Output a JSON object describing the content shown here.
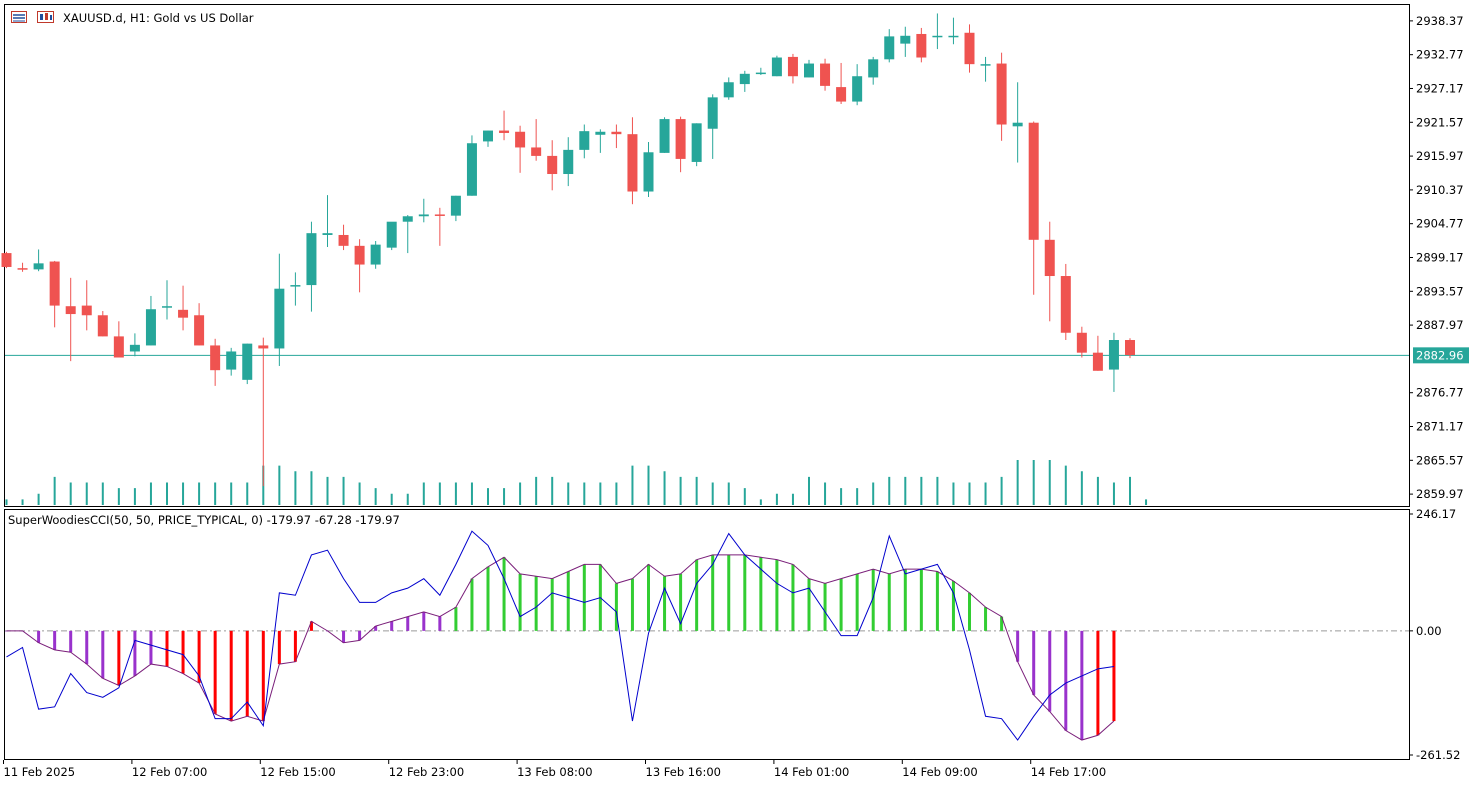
{
  "header": {
    "symbol_title": "XAUUSD.d, H1:  Gold vs US Dollar",
    "indicator_title": "SuperWoodiesCCI(50, 50, PRICE_TYPICAL, 0) -179.97 -67.28 -179.97"
  },
  "icons": {
    "symbol_icon": "chart-window-icon",
    "indicator_icon": "indicator-icon"
  },
  "colors": {
    "bull": "#26a69a",
    "bear": "#ef5350",
    "volume": "#26a69a",
    "price_line": "#26a69a",
    "cci_green": "#32cd32",
    "cci_red": "#ff0000",
    "cci_purple": "#9932cc",
    "cci_line_main": "#0000cd",
    "cci_line_turbo": "#7a1f7a"
  },
  "current_price_label": "2882.96",
  "chart_data": [
    {
      "type": "candlestick",
      "title": "XAUUSD.d, H1:  Gold vs US Dollar",
      "ylim": [
        2858.0,
        2941.0
      ],
      "y_ticks": [
        "2938.37",
        "2932.77",
        "2927.17",
        "2921.57",
        "2915.97",
        "2910.37",
        "2904.77",
        "2899.17",
        "2893.57",
        "2887.97",
        "2876.77",
        "2871.17",
        "2865.57",
        "2859.97"
      ],
      "x_ticks": [
        "11 Feb 2025",
        "12 Feb 07:00",
        "12 Feb 15:00",
        "12 Feb 23:00",
        "13 Feb 08:00",
        "13 Feb 16:00",
        "14 Feb 01:00",
        "14 Feb 09:00",
        "14 Feb 17:00"
      ],
      "x_tick_bars": [
        0,
        8,
        16,
        24,
        32,
        40,
        48,
        56,
        64
      ],
      "current_price": 2882.96,
      "ohlc": [
        [
          2899.9,
          2900.1,
          2897.4,
          2897.6
        ],
        [
          2897.4,
          2898.3,
          2896.8,
          2897.2
        ],
        [
          2897.2,
          2900.5,
          2896.9,
          2898.2
        ],
        [
          2898.5,
          2898.6,
          2887.6,
          2891.2
        ],
        [
          2891.1,
          2895.8,
          2882.0,
          2889.8
        ],
        [
          2891.2,
          2895.4,
          2887.1,
          2889.6
        ],
        [
          2889.6,
          2890.3,
          2886.1,
          2886.1
        ],
        [
          2886.1,
          2888.6,
          2883.1,
          2882.6
        ],
        [
          2883.6,
          2886.6,
          2882.8,
          2884.7
        ],
        [
          2884.6,
          2892.8,
          2884.6,
          2890.6
        ],
        [
          2891.1,
          2895.4,
          2888.9,
          2891.1
        ],
        [
          2890.5,
          2894.5,
          2887.1,
          2889.2
        ],
        [
          2889.6,
          2891.6,
          2884.6,
          2884.6
        ],
        [
          2884.6,
          2885.7,
          2877.9,
          2880.5
        ],
        [
          2880.6,
          2884.2,
          2879.6,
          2883.6
        ],
        [
          2878.9,
          2884.9,
          2878.2,
          2884.9
        ],
        [
          2884.6,
          2885.9,
          2861.3,
          2884.1
        ],
        [
          2884.1,
          2899.8,
          2881.2,
          2894.0
        ],
        [
          2894.5,
          2896.7,
          2891.2,
          2894.6
        ],
        [
          2894.6,
          2905.1,
          2890.2,
          2903.2
        ],
        [
          2902.9,
          2909.5,
          2900.9,
          2903.2
        ],
        [
          2902.9,
          2904.6,
          2900.4,
          2901.1
        ],
        [
          2901.1,
          2902.2,
          2893.4,
          2898.0
        ],
        [
          2898.0,
          2901.9,
          2897.3,
          2901.3
        ],
        [
          2900.8,
          2904.6,
          2900.4,
          2905.1
        ],
        [
          2905.1,
          2906.2,
          2899.9,
          2906.0
        ],
        [
          2906.0,
          2908.9,
          2905.0,
          2906.3
        ],
        [
          2906.3,
          2907.4,
          2901.1,
          2906.1
        ],
        [
          2906.1,
          2909.4,
          2905.2,
          2909.4
        ],
        [
          2909.4,
          2919.4,
          2909.4,
          2918.1
        ],
        [
          2918.4,
          2920.2,
          2917.5,
          2920.2
        ],
        [
          2920.2,
          2923.5,
          2918.6,
          2919.8
        ],
        [
          2920.0,
          2921.0,
          2913.2,
          2917.4
        ],
        [
          2917.4,
          2922.1,
          2915.2,
          2916.0
        ],
        [
          2916.0,
          2918.6,
          2910.3,
          2913.0
        ],
        [
          2913.0,
          2919.1,
          2911.0,
          2917.0
        ],
        [
          2917.0,
          2921.2,
          2915.6,
          2920.1
        ],
        [
          2919.5,
          2920.4,
          2916.5,
          2920.0
        ],
        [
          2920.0,
          2921.2,
          2917.3,
          2919.6
        ],
        [
          2919.6,
          2922.4,
          2908.0,
          2910.1
        ],
        [
          2910.1,
          2918.3,
          2909.2,
          2916.6
        ],
        [
          2916.5,
          2922.4,
          2916.5,
          2922.1
        ],
        [
          2922.1,
          2922.5,
          2913.3,
          2915.5
        ],
        [
          2915.0,
          2921.4,
          2914.3,
          2921.4
        ],
        [
          2920.5,
          2926.2,
          2915.5,
          2925.7
        ],
        [
          2925.7,
          2929.0,
          2925.3,
          2928.2
        ],
        [
          2927.9,
          2930.1,
          2926.6,
          2929.6
        ],
        [
          2929.6,
          2930.6,
          2929.4,
          2929.8
        ],
        [
          2929.2,
          2932.6,
          2929.2,
          2932.3
        ],
        [
          2932.4,
          2932.9,
          2928.0,
          2929.2
        ],
        [
          2929.0,
          2931.9,
          2929.0,
          2931.3
        ],
        [
          2931.3,
          2932.1,
          2926.8,
          2927.6
        ],
        [
          2927.4,
          2931.4,
          2924.6,
          2925.0
        ],
        [
          2925.0,
          2931.2,
          2924.4,
          2929.2
        ],
        [
          2929.0,
          2932.4,
          2927.8,
          2932.0
        ],
        [
          2932.0,
          2937.0,
          2931.5,
          2935.8
        ],
        [
          2934.6,
          2937.4,
          2932.4,
          2935.9
        ],
        [
          2936.2,
          2937.2,
          2931.5,
          2932.3
        ],
        [
          2935.9,
          2939.6,
          2933.7,
          2935.9
        ],
        [
          2935.7,
          2938.9,
          2934.5,
          2935.9
        ],
        [
          2936.4,
          2937.8,
          2929.8,
          2931.2
        ],
        [
          2931.2,
          2932.4,
          2928.3,
          2931.2
        ],
        [
          2931.3,
          2933.1,
          2918.5,
          2921.2
        ],
        [
          2920.9,
          2928.2,
          2914.9,
          2921.5
        ],
        [
          2921.5,
          2921.7,
          2893.0,
          2902.1
        ],
        [
          2902.1,
          2905.1,
          2888.6,
          2896.1
        ],
        [
          2896.1,
          2898.1,
          2885.5,
          2886.7
        ],
        [
          2886.7,
          2887.7,
          2882.6,
          2883.4
        ],
        [
          2883.4,
          2886.2,
          2880.4,
          2880.4
        ],
        [
          2880.6,
          2886.7,
          2876.9,
          2885.5
        ],
        [
          2885.5,
          2885.8,
          2882.5,
          2883.0
        ]
      ],
      "volume": [
        1,
        1,
        2,
        5,
        4,
        4,
        4,
        3,
        3,
        4,
        4,
        4,
        4,
        4,
        4,
        4,
        7,
        7,
        6,
        6,
        5,
        5,
        4,
        3,
        2,
        2,
        4,
        4,
        4,
        4,
        3,
        3,
        4,
        5,
        5,
        4,
        4,
        4,
        4,
        7,
        7,
        6,
        5,
        5,
        4,
        4,
        3,
        1,
        2,
        2,
        5,
        4,
        3,
        3,
        4,
        5,
        5,
        5,
        5,
        4,
        4,
        4,
        5,
        8,
        8,
        8,
        7,
        6,
        5,
        4,
        5,
        1
      ],
      "volume_max": 8
    },
    {
      "type": "line-histogram",
      "title": "SuperWoodiesCCI(50, 50, PRICE_TYPICAL, 0)",
      "ylim": [
        -261.52,
        246.17
      ],
      "y_ticks": [
        "246.17",
        "0.00",
        "-261.52"
      ],
      "zero_line": 0.0,
      "hist": [
        0,
        0,
        -25,
        -40,
        -45,
        -70,
        -100,
        -115,
        -95,
        -70,
        -75,
        -90,
        -110,
        -175,
        -190,
        -180,
        -190,
        -70,
        -65,
        20,
        0,
        -25,
        -20,
        10,
        20,
        30,
        40,
        30,
        50,
        110,
        135,
        155,
        120,
        115,
        110,
        125,
        140,
        140,
        100,
        110,
        140,
        115,
        120,
        150,
        160,
        160,
        160,
        155,
        150,
        140,
        110,
        100,
        110,
        120,
        130,
        120,
        130,
        130,
        125,
        105,
        80,
        50,
        30,
        -65,
        -135,
        -170,
        -210,
        -230,
        -220,
        -190
      ],
      "hist_colors": [
        "p",
        "p",
        "p",
        "p",
        "p",
        "p",
        "p",
        "r",
        "p",
        "p",
        "r",
        "r",
        "r",
        "r",
        "r",
        "r",
        "r",
        "r",
        "r",
        "r",
        "p",
        "p",
        "p",
        "p",
        "p",
        "p",
        "p",
        "p",
        "g",
        "g",
        "g",
        "g",
        "g",
        "g",
        "g",
        "g",
        "g",
        "g",
        "g",
        "g",
        "g",
        "g",
        "g",
        "g",
        "g",
        "g",
        "g",
        "g",
        "g",
        "g",
        "g",
        "g",
        "g",
        "g",
        "g",
        "g",
        "g",
        "g",
        "g",
        "g",
        "g",
        "g",
        "g",
        "p",
        "p",
        "p",
        "p",
        "p",
        "r",
        "r"
      ],
      "cci_main": [
        -55,
        -35,
        -165,
        -160,
        -90,
        -130,
        -140,
        -120,
        -20,
        -30,
        -40,
        -50,
        -95,
        -185,
        -185,
        -150,
        -200,
        80,
        75,
        160,
        170,
        110,
        60,
        60,
        80,
        90,
        110,
        75,
        140,
        210,
        180,
        110,
        30,
        50,
        80,
        70,
        60,
        70,
        40,
        -190,
        -5,
        90,
        15,
        100,
        140,
        205,
        160,
        130,
        100,
        80,
        90,
        40,
        -10,
        -10,
        70,
        200,
        120,
        130,
        140,
        80,
        -40,
        -180,
        -185,
        -230,
        -180,
        -135,
        -110,
        -95,
        -80,
        -75
      ],
      "cci_turbo": [
        0,
        0,
        -25,
        -40,
        -45,
        -70,
        -100,
        -115,
        -95,
        -70,
        -75,
        -90,
        -110,
        -175,
        -190,
        -180,
        -190,
        -70,
        -65,
        20,
        0,
        -25,
        -20,
        10,
        20,
        30,
        40,
        30,
        50,
        110,
        135,
        155,
        120,
        115,
        110,
        125,
        140,
        140,
        100,
        110,
        140,
        115,
        120,
        150,
        160,
        160,
        160,
        155,
        150,
        140,
        110,
        100,
        110,
        120,
        130,
        120,
        130,
        130,
        125,
        105,
        80,
        50,
        30,
        -65,
        -135,
        -170,
        -210,
        -230,
        -220,
        -190
      ]
    }
  ]
}
